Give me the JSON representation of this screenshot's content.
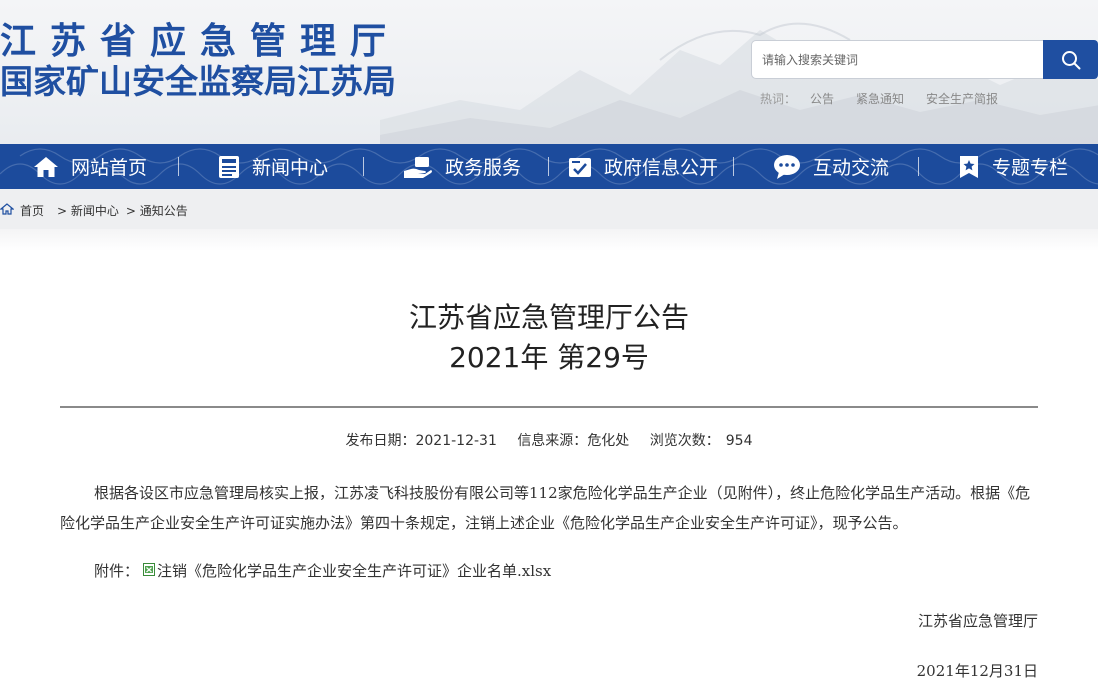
{
  "header": {
    "logo_line1": "江苏省应急管理厅",
    "logo_line2": "国家矿山安全监察局江苏局",
    "search_placeholder": "请输入搜索关键词",
    "hot_label": "热词：",
    "hot_words": [
      "公告",
      "紧急通知",
      "安全生产简报"
    ],
    "brand_color": "#1f4fa1"
  },
  "nav": {
    "items": [
      {
        "label": "网站首页",
        "icon": "home-icon"
      },
      {
        "label": "新闻中心",
        "icon": "news-icon"
      },
      {
        "label": "政务服务",
        "icon": "service-icon"
      },
      {
        "label": "政府信息公开",
        "icon": "info-icon"
      },
      {
        "label": "互动交流",
        "icon": "chat-icon"
      },
      {
        "label": "专题专栏",
        "icon": "bookmark-icon"
      }
    ],
    "color": "#1c4b9c"
  },
  "breadcrumb": {
    "home": "首页",
    "items": [
      "> 新闻中心",
      "> 通知公告"
    ]
  },
  "article": {
    "title_line1": "江苏省应急管理厅公告",
    "title_line2": "2021年 第29号",
    "publish_label": "发布日期：",
    "publish_date": "2021-12-31",
    "source_label": "信息来源：",
    "source": "危化处",
    "views_label": "浏览次数：",
    "views": "954",
    "body": "根据各设区市应急管理局核实上报，江苏凌飞科技股份有限公司等112家危险化学品生产企业（见附件），终止危险化学品生产活动。根据《危险化学品生产企业安全生产许可证实施办法》第四十条规定，注销上述企业《危险化学品生产企业安全生产许可证》，现予公告。",
    "attachment_label": "附件：",
    "attachment_name": "注销《危险化学品生产企业安全生产许可证》企业名单.xlsx",
    "signer": "江苏省应急管理厅",
    "sign_date": "2021年12月31日"
  }
}
